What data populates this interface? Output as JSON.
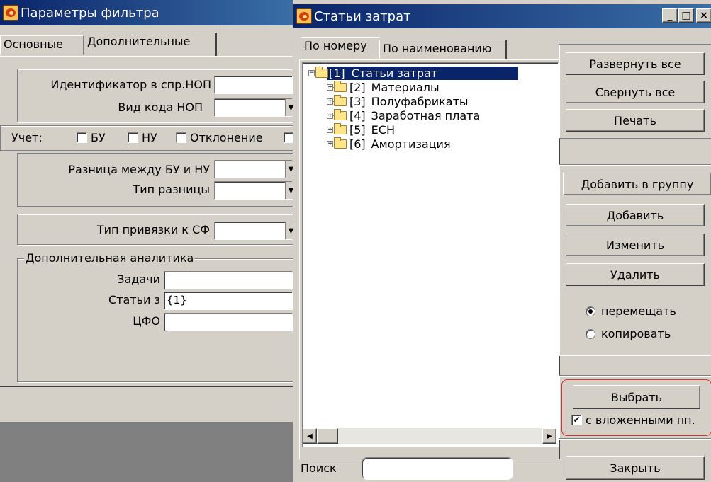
{
  "filter_window": {
    "title": "Параметры фильтра",
    "tabs": [
      "Основные",
      "Дополнительные"
    ],
    "fields": {
      "id_nop_label": "Идентификатор в спр.НОП",
      "code_nop_label": "Вид кода НОП",
      "uchet_label": "Учет:",
      "bu_label": "БУ",
      "nu_label": "НУ",
      "deviation_label": "Отклонение",
      "diff_label": "Разница между БУ и НУ",
      "diff_type_label": "Тип разницы",
      "sf_label": "Тип привязки к СФ",
      "analytics_legend": "Дополнительная аналитика",
      "tasks_label": "Задачи",
      "articles_label": "Статьи з",
      "articles_value": "{1}",
      "cfo_label": "ЦФО"
    }
  },
  "cost_window": {
    "title": "Статьи затрат",
    "caption_buttons": [
      "_",
      "□",
      "×"
    ],
    "tabs": [
      "По номеру",
      "По наименованию"
    ],
    "tree": [
      {
        "num": "[1]",
        "name": "Статьи затрат",
        "expander": "−"
      },
      {
        "num": "[2]",
        "name": "Материалы",
        "expander": "+"
      },
      {
        "num": "[3]",
        "name": "Полуфабрикаты",
        "expander": "+"
      },
      {
        "num": "[4]",
        "name": "Заработная плата",
        "expander": "+"
      },
      {
        "num": "[5]",
        "name": "ЕСН",
        "expander": "+"
      },
      {
        "num": "[6]",
        "name": "Амортизация",
        "expander": "+"
      }
    ],
    "scroll_left": "◀",
    "scroll_right": "▶",
    "search_label": "Поиск",
    "search_value": "",
    "buttons": {
      "expand_all": "Развернуть все",
      "collapse_all": "Свернуть все",
      "print": "Печать",
      "add_to_group": "Добавить в группу",
      "add": "Добавить",
      "edit": "Изменить",
      "delete": "Удалить",
      "select": "Выбрать",
      "close": "Закрыть"
    },
    "radio": {
      "move": "перемещать",
      "copy": "копировать",
      "selected": "move"
    },
    "nested_checkbox": {
      "label": "с вложенными пп.",
      "checked": true,
      "mark": "✔"
    }
  },
  "colors": {
    "title_active": "#0a246a",
    "selection": "#0a246a",
    "highlight_outline": "#e03030",
    "face": "#d4d0c8"
  }
}
